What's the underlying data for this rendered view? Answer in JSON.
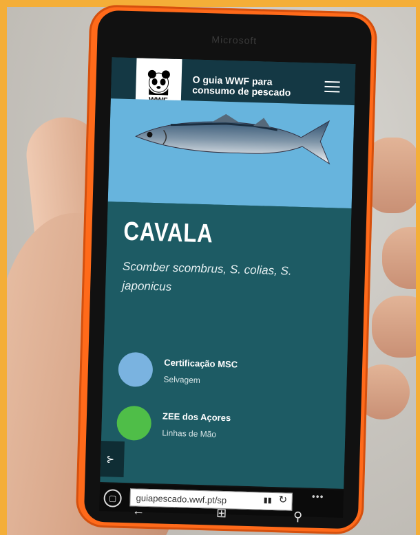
{
  "phone": {
    "brand": "Microsoft"
  },
  "app": {
    "logo_text": "WWF",
    "title": "O guia WWF para consumo de pescado",
    "menu_icon": "hamburger-menu-icon"
  },
  "species": {
    "name": "CAVALA",
    "scientific": "Scomber scombrus, S. colias, S. japonicus"
  },
  "certifications": [
    {
      "title": "Certificação MSC",
      "subtitle": "Selvagem",
      "color": "#7ab3e0"
    },
    {
      "title": "ZEE dos Açores",
      "subtitle": "Linhas de Mão",
      "color": "#4fbe48"
    }
  ],
  "browser": {
    "address": "guiapescado.wwf.pt/sp"
  },
  "colors": {
    "header": "#143844",
    "hero": "#67b4dd",
    "content": "#1d5b64",
    "frame": "#f4ae38",
    "phone_body": "#ff6a1a"
  }
}
